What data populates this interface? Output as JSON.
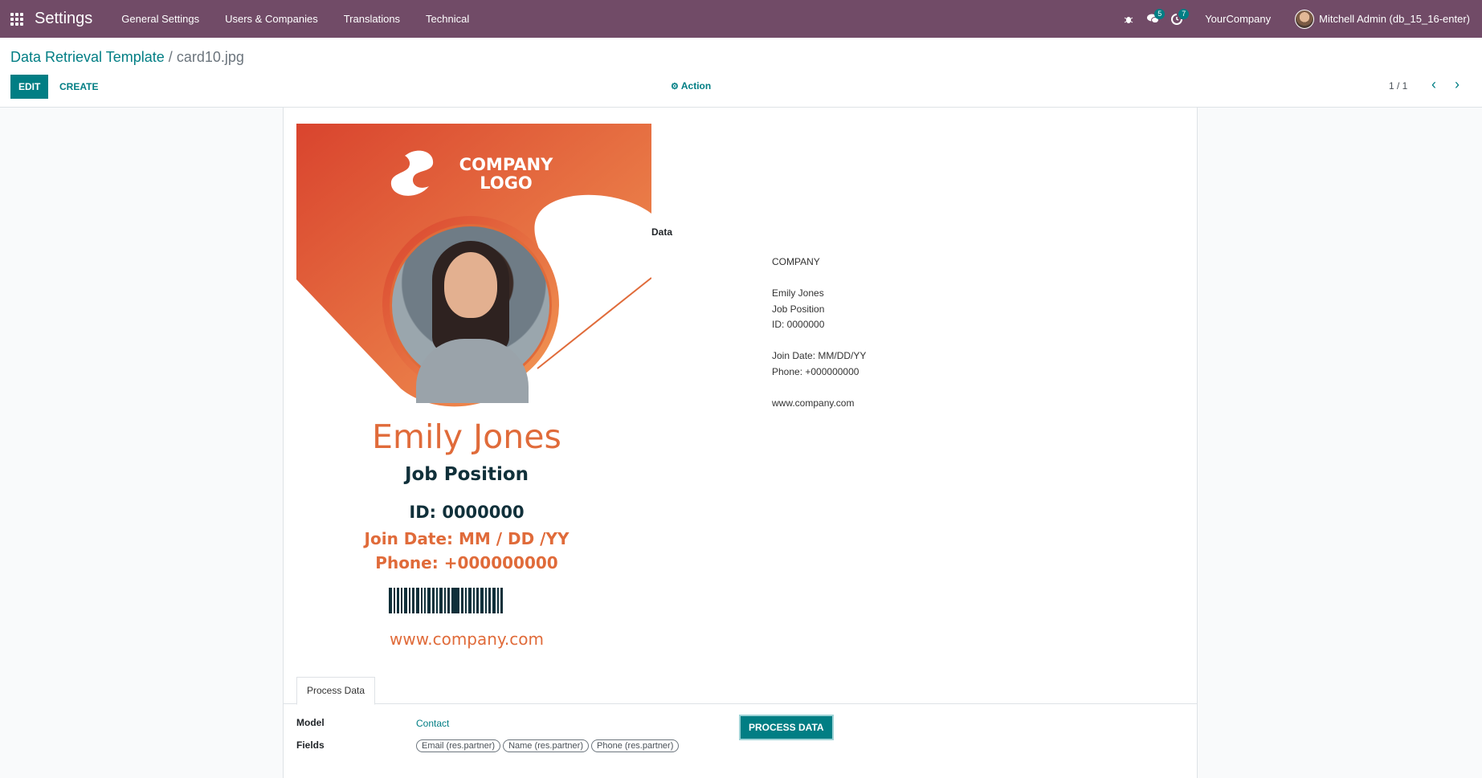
{
  "navbar": {
    "app_name": "Settings",
    "menu": [
      "General Settings",
      "Users & Companies",
      "Translations",
      "Technical"
    ],
    "messages_count": "5",
    "activities_count": "7",
    "company": "YourCompany",
    "user": "Mitchell Admin (db_15_16-enter)"
  },
  "control": {
    "breadcrumb_parent": "Data Retrieval Template",
    "breadcrumb_separator": "/",
    "breadcrumb_current": "card10.jpg",
    "edit_label": "EDIT",
    "create_label": "CREATE",
    "action_label": "Action",
    "pager": "1 / 1"
  },
  "form": {
    "data_label": "Data",
    "data_lines": [
      "COMPANY",
      "",
      "Emily Jones",
      "Job Position",
      "ID: 0000000",
      "",
      "Join Date: MM/DD/YY",
      "Phone: +000000000",
      "",
      "www.company.com"
    ],
    "card": {
      "logo_text_1": "COMPANY",
      "logo_text_2": "LOGO",
      "name": "Emily Jones",
      "job": "Job Position",
      "id": "ID: 0000000",
      "join": "Join Date: MM / DD /YY",
      "phone": "Phone: +000000000",
      "web": "www.company.com",
      "accent": "#e06b3a",
      "dark": "#10303a"
    },
    "tab_label": "Process Data",
    "model_label": "Model",
    "model_value": "Contact",
    "fields_label": "Fields",
    "fields": [
      "Email (res.partner)",
      "Name (res.partner)",
      "Phone (res.partner)"
    ],
    "process_button": "PROCESS DATA"
  },
  "colors": {
    "navbar": "#714b67",
    "primary": "#017e84"
  }
}
